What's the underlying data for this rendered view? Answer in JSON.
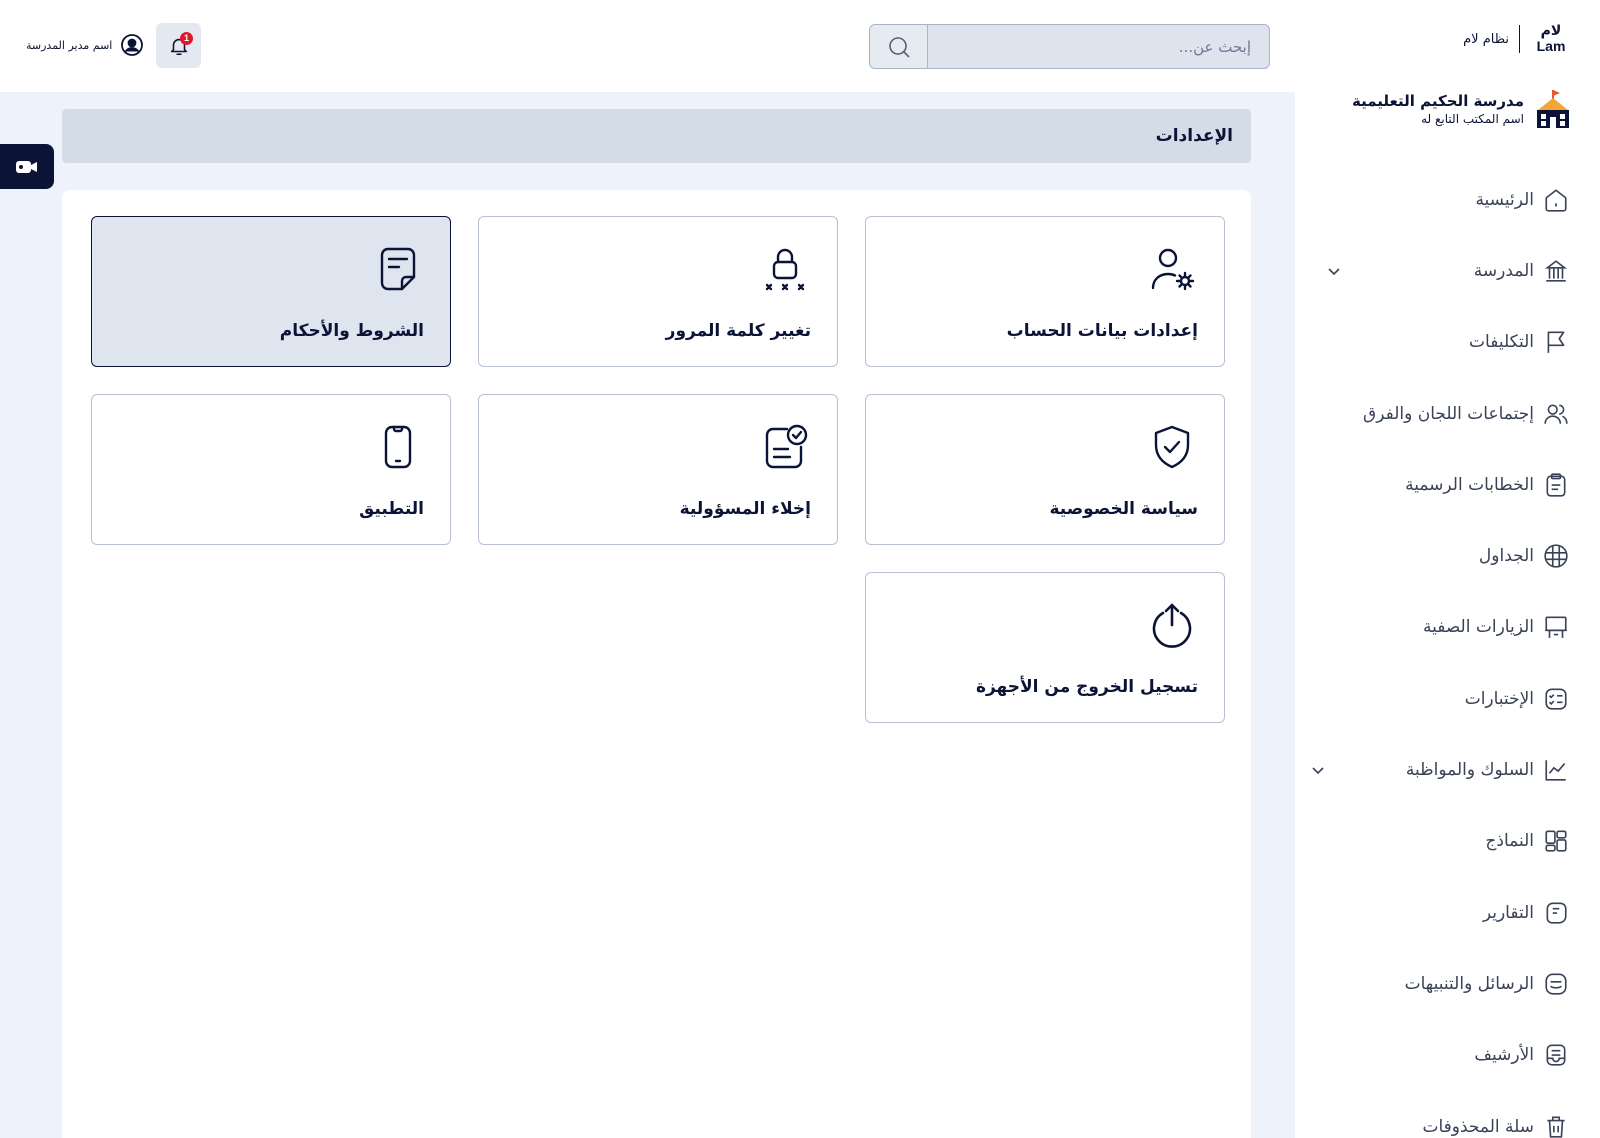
{
  "brand": {
    "logo_ar": "لام",
    "logo_en": "Lam",
    "system_name": "نظام لام"
  },
  "search": {
    "placeholder": "إبحث عن..."
  },
  "notifications": {
    "count": "1"
  },
  "user": {
    "name": "اسم مدير المدرسة"
  },
  "school": {
    "name": "مدرسة الحكيم التعليمية",
    "office": "اسم المكتب التابع له"
  },
  "sidebar": {
    "items": [
      {
        "label": "الرئيسية",
        "icon": "home-icon"
      },
      {
        "label": "المدرسة",
        "icon": "school-building-icon",
        "has_submenu": true
      },
      {
        "label": "التكليفات",
        "icon": "flag-icon"
      },
      {
        "label": "إجتماعات اللجان والفرق",
        "icon": "users-group-icon"
      },
      {
        "label": "الخطابات الرسمية",
        "icon": "clipboard-icon"
      },
      {
        "label": "الجداول",
        "icon": "grid-table-icon"
      },
      {
        "label": "الزيارات الصفية",
        "icon": "classroom-board-icon"
      },
      {
        "label": "الإختبارات",
        "icon": "checklist-icon"
      },
      {
        "label": "السلوك والمواظبة",
        "icon": "chart-line-icon",
        "has_submenu": true
      },
      {
        "label": "النماذج",
        "icon": "templates-icon"
      },
      {
        "label": "التقارير",
        "icon": "reports-icon"
      },
      {
        "label": "الرسائل والتنبيهات",
        "icon": "messages-icon"
      },
      {
        "label": "الأرشيف",
        "icon": "archive-icon"
      },
      {
        "label": "سلة المحذوفات",
        "icon": "trash-icon"
      }
    ]
  },
  "page": {
    "title": "الإعدادات"
  },
  "settings_cards": [
    {
      "label": "إعدادات بيانات الحساب",
      "icon": "user-settings-icon",
      "active": false
    },
    {
      "label": "تغيير كلمة المرور",
      "icon": "lock-password-icon",
      "active": false
    },
    {
      "label": "الشروط والأحكام",
      "icon": "terms-document-icon",
      "active": true
    },
    {
      "label": "سياسة الخصوصية",
      "icon": "shield-check-icon",
      "active": false
    },
    {
      "label": "إخلاء المسؤولية",
      "icon": "disclaimer-icon",
      "active": false
    },
    {
      "label": "التطبيق",
      "icon": "mobile-app-icon",
      "active": false
    },
    {
      "label": "تسجيل الخروج من الأجهزة",
      "icon": "power-logout-icon",
      "active": false
    }
  ],
  "colors": {
    "primary": "#0b1437",
    "content_bg": "#eef2fb",
    "title_bar": "#d4dce8",
    "badge": "#e0182d"
  }
}
